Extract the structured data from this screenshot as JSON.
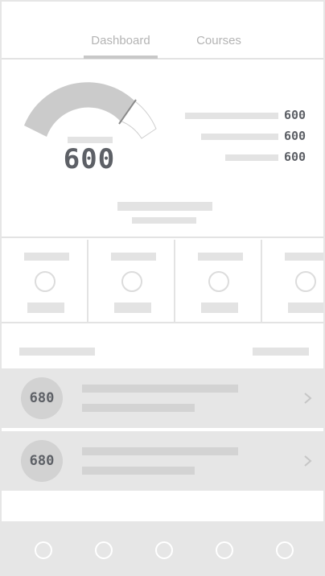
{
  "tabs": [
    {
      "label": "Dashboard",
      "active": true
    },
    {
      "label": "Courses",
      "active": false
    }
  ],
  "gauge": {
    "value": "600",
    "stats": [
      "600",
      "600",
      "600"
    ]
  },
  "cards": [
    {
      "icon": "circle-icon"
    },
    {
      "icon": "circle-icon"
    },
    {
      "icon": "circle-icon"
    },
    {
      "icon": "circle-icon"
    }
  ],
  "list": {
    "items": [
      {
        "badge": "680",
        "icon": "chevron-right-icon"
      },
      {
        "badge": "680",
        "icon": "chevron-right-icon"
      }
    ]
  },
  "bottom_nav": {
    "items": [
      {
        "icon": "circle-icon"
      },
      {
        "icon": "circle-icon"
      },
      {
        "icon": "circle-icon"
      },
      {
        "icon": "circle-icon"
      },
      {
        "icon": "circle-icon"
      }
    ]
  },
  "colors": {
    "placeholder": "#e3e3e3",
    "text": "#5d6066",
    "row_bg": "#e6e6e6"
  }
}
